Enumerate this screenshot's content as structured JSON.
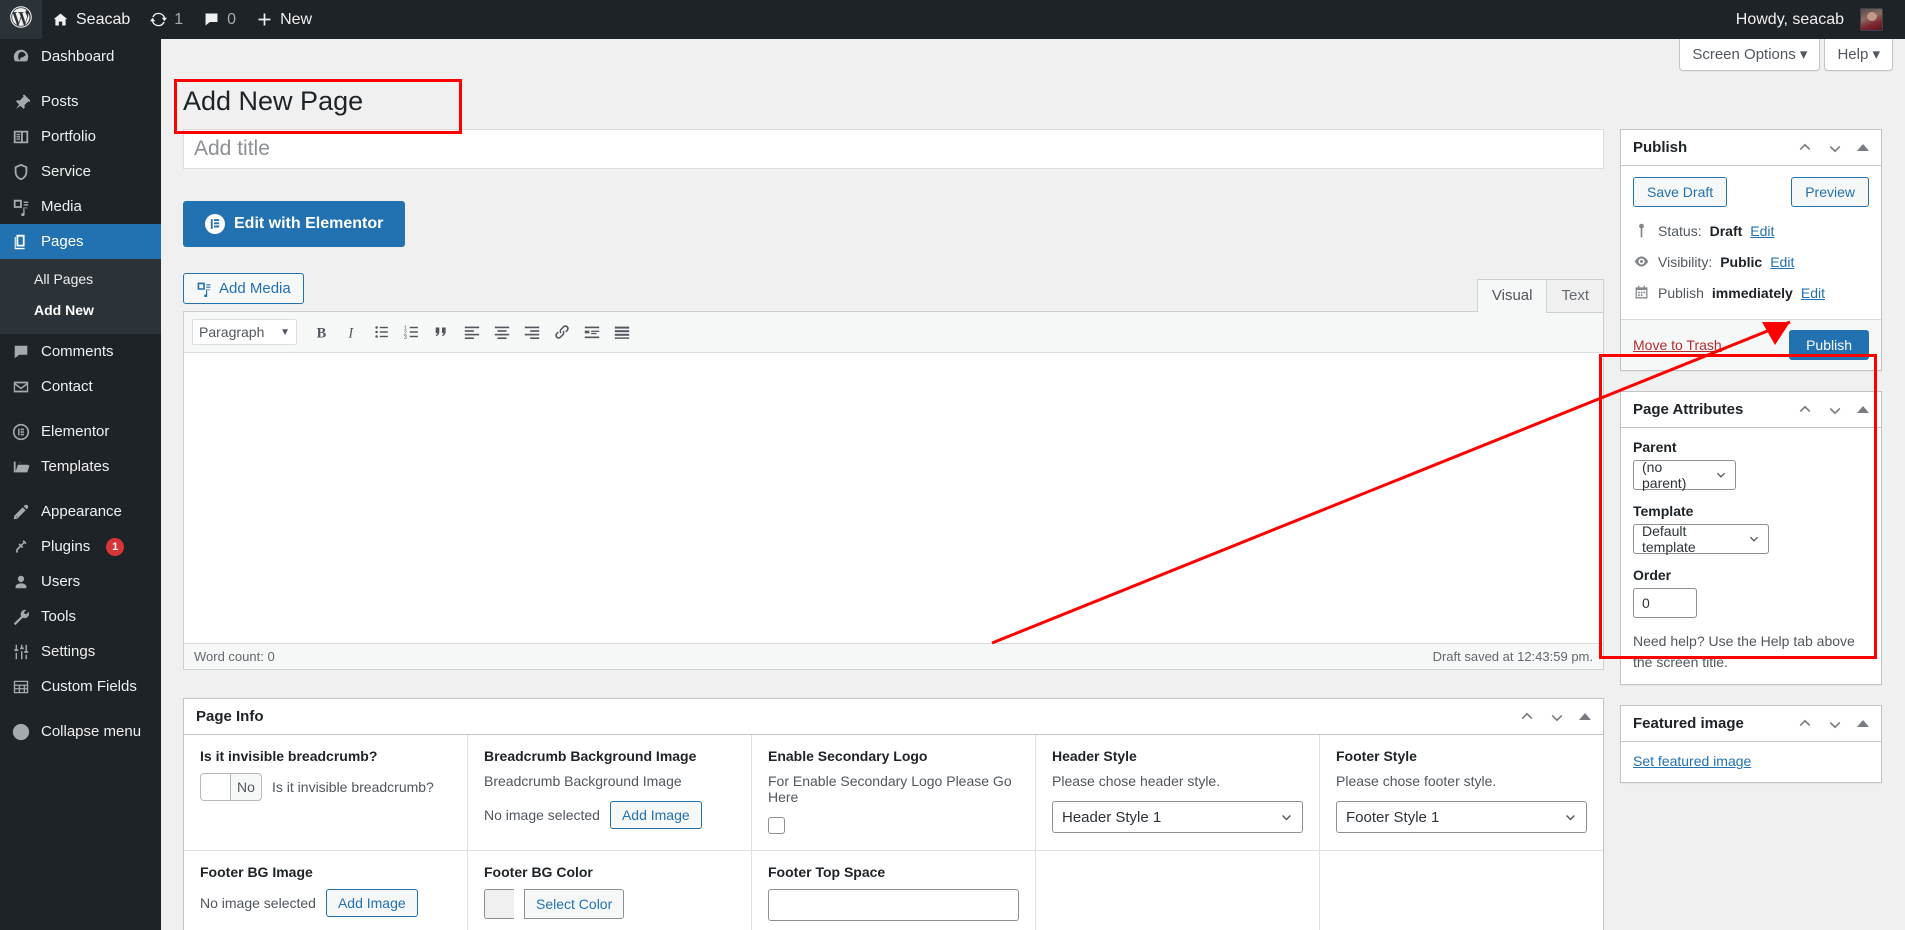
{
  "adminbar": {
    "site_name": "Seacab",
    "updates_count": "1",
    "comments_count": "0",
    "new_label": "New",
    "howdy": "Howdy, seacab"
  },
  "screen_meta": {
    "screen_options": "Screen Options",
    "help": "Help",
    "caret": "▾"
  },
  "sidebar": {
    "items": [
      {
        "label": "Dashboard",
        "icon": "dashboard-icon"
      },
      {
        "label": "Posts",
        "icon": "pin-icon"
      },
      {
        "label": "Portfolio",
        "icon": "portfolio-icon"
      },
      {
        "label": "Service",
        "icon": "shield-icon"
      },
      {
        "label": "Media",
        "icon": "media-icon"
      },
      {
        "label": "Pages",
        "icon": "pages-icon",
        "current": true
      },
      {
        "label": "Comments",
        "icon": "comment-icon"
      },
      {
        "label": "Contact",
        "icon": "mail-icon"
      },
      {
        "label": "Elementor",
        "icon": "elementor-icon"
      },
      {
        "label": "Templates",
        "icon": "folder-icon"
      },
      {
        "label": "Appearance",
        "icon": "brush-icon"
      },
      {
        "label": "Plugins",
        "icon": "plug-icon",
        "badge": "1"
      },
      {
        "label": "Users",
        "icon": "user-icon"
      },
      {
        "label": "Tools",
        "icon": "wrench-icon"
      },
      {
        "label": "Settings",
        "icon": "sliders-icon"
      },
      {
        "label": "Custom Fields",
        "icon": "grid-icon"
      },
      {
        "label": "Collapse menu",
        "icon": "collapse-icon"
      }
    ],
    "submenu": [
      {
        "label": "All Pages"
      },
      {
        "label": "Add New",
        "current": true
      }
    ]
  },
  "page": {
    "title": "Add New Page",
    "title_placeholder": "Add title",
    "title_value": ""
  },
  "editor": {
    "elementor_button": "Edit with Elementor",
    "add_media": "Add Media",
    "tabs": [
      {
        "label": "Visual",
        "active": true
      },
      {
        "label": "Text",
        "active": false
      }
    ],
    "format_select": "Paragraph",
    "toolbar_icons": [
      "bold-icon",
      "italic-icon",
      "bulleted-list-icon",
      "numbered-list-icon",
      "blockquote-icon",
      "align-left-icon",
      "align-center-icon",
      "align-right-icon",
      "link-icon",
      "read-more-icon",
      "toolbar-toggle-icon"
    ],
    "content": "",
    "word_count": "Word count: 0",
    "draft_saved": "Draft saved at 12:43:59 pm."
  },
  "publish_box": {
    "title": "Publish",
    "save_draft": "Save Draft",
    "preview": "Preview",
    "status_label": "Status:",
    "status_value": "Draft",
    "visibility_label": "Visibility:",
    "visibility_value": "Public",
    "schedule_label": "Publish",
    "schedule_value": "immediately",
    "edit": "Edit",
    "move_to_trash": "Move to Trash",
    "publish": "Publish"
  },
  "page_attributes": {
    "title": "Page Attributes",
    "parent_label": "Parent",
    "parent_value": "(no parent)",
    "template_label": "Template",
    "template_value": "Default template",
    "order_label": "Order",
    "order_value": "0",
    "help_text": "Need help? Use the Help tab above the screen title."
  },
  "featured_image": {
    "title": "Featured image",
    "set_link": "Set featured image"
  },
  "page_info": {
    "title": "Page Info",
    "rows": [
      [
        {
          "label": "Is it invisible breadcrumb?",
          "control": "toggle",
          "toggle_value": "No",
          "toggle_text": "Is it invisible breadcrumb?"
        },
        {
          "label": "Breadcrumb Background Image",
          "desc": "Breadcrumb Background Image",
          "control": "image",
          "no_image": "No image selected",
          "button": "Add Image"
        },
        {
          "label": "Enable Secondary Logo",
          "desc": "For Enable Secondary Logo Please Go Here",
          "control": "checkbox"
        },
        {
          "label": "Header Style",
          "desc": "Please chose header style.",
          "control": "select",
          "value": "Header Style 1"
        },
        {
          "label": "Footer Style",
          "desc": "Please chose footer style.",
          "control": "select",
          "value": "Footer Style 1"
        }
      ],
      [
        {
          "label": "Footer BG Image",
          "control": "image",
          "no_image": "No image selected",
          "button": "Add Image"
        },
        {
          "label": "Footer BG Color",
          "control": "color",
          "button": "Select Color"
        },
        {
          "label": "Footer Top Space",
          "control": "input",
          "value": ""
        }
      ]
    ]
  },
  "colors": {
    "wp_blue": "#2271b1",
    "admin_dark": "#1d2327",
    "annotation_red": "#ff0000",
    "badge_red": "#d63638"
  }
}
